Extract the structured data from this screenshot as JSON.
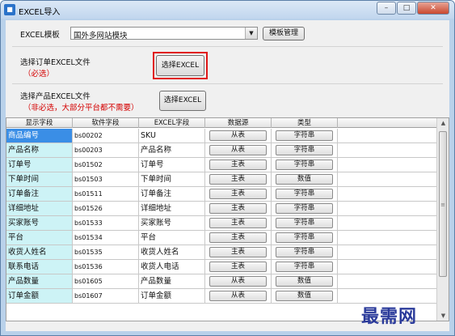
{
  "window": {
    "title": "EXCEL导入",
    "icon": "excel-app-icon",
    "controls": {
      "minimize": "–",
      "maximize": "□",
      "close": "✕"
    }
  },
  "template": {
    "label": "EXCEL模板",
    "selected": "国外多网站模块",
    "manage_button": "模板管理"
  },
  "order_file": {
    "label": "选择订单EXCEL文件",
    "note": "（必选）",
    "button": "选择EXCEL"
  },
  "product_file": {
    "label": "选择产品EXCEL文件",
    "note": "（非必选，大部分平台都不需要）",
    "button": "选择EXCEL"
  },
  "grid": {
    "columns": [
      "显示字段",
      "软件字段",
      "EXCEL字段",
      "数据源",
      "类型"
    ],
    "rows": [
      {
        "display": "商品编号",
        "soft": "bs00202",
        "excel": "SKU",
        "source": "从表",
        "type": "字符串",
        "selected": true
      },
      {
        "display": "产品名称",
        "soft": "bs00203",
        "excel": "产品名称",
        "source": "从表",
        "type": "字符串"
      },
      {
        "display": "订单号",
        "soft": "bs01502",
        "excel": "订单号",
        "source": "主表",
        "type": "字符串"
      },
      {
        "display": "下单时间",
        "soft": "bs01503",
        "excel": "下单时间",
        "source": "主表",
        "type": "数值"
      },
      {
        "display": "订单备注",
        "soft": "bs01511",
        "excel": "订单备注",
        "source": "主表",
        "type": "字符串"
      },
      {
        "display": "详细地址",
        "soft": "bs01526",
        "excel": "详细地址",
        "source": "主表",
        "type": "字符串"
      },
      {
        "display": "买家账号",
        "soft": "bs01533",
        "excel": "买家账号",
        "source": "主表",
        "type": "字符串"
      },
      {
        "display": "平台",
        "soft": "bs01534",
        "excel": "平台",
        "source": "主表",
        "type": "字符串"
      },
      {
        "display": "收货人姓名",
        "soft": "bs01535",
        "excel": "收货人姓名",
        "source": "主表",
        "type": "字符串"
      },
      {
        "display": "联系电话",
        "soft": "bs01536",
        "excel": "收货人电话",
        "source": "主表",
        "type": "字符串"
      },
      {
        "display": "产品数量",
        "soft": "bs01605",
        "excel": "产品数量",
        "source": "从表",
        "type": "数值"
      },
      {
        "display": "订单金额",
        "soft": "bs01607",
        "excel": "订单金额",
        "source": "从表",
        "type": "数值"
      }
    ]
  },
  "watermark": "最需网",
  "colors": {
    "highlight": "#e01717",
    "note_red": "#d40000",
    "selected_row": "#3a8ee6",
    "display_col_bg": "#cdf3f6"
  }
}
